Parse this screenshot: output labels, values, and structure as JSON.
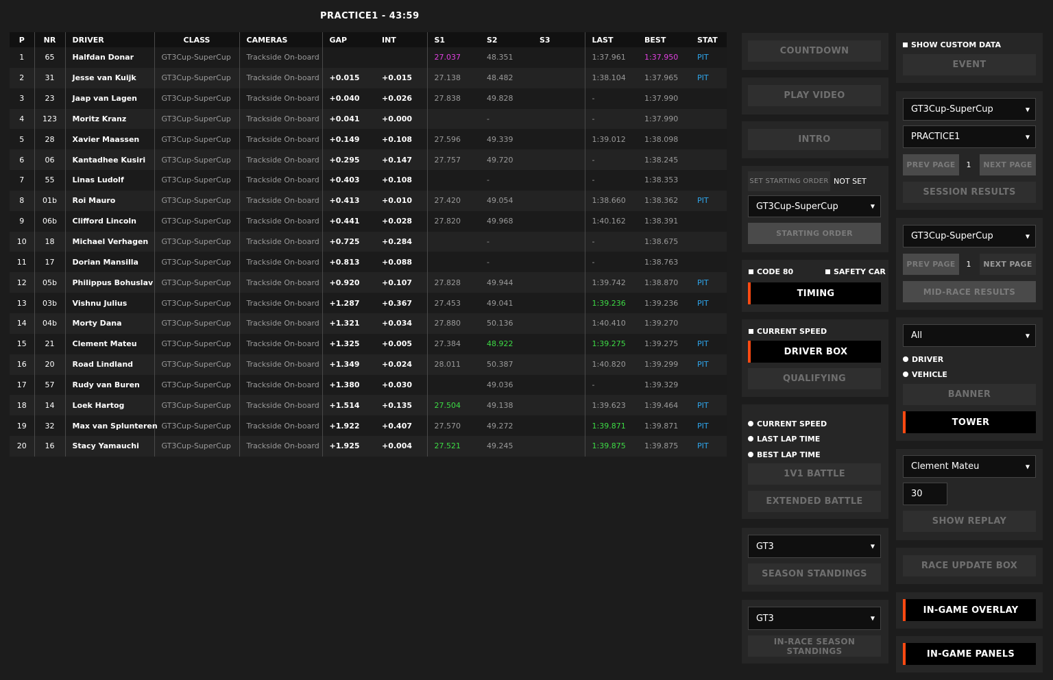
{
  "session_title": "PRACTICE1 - 43:59",
  "columns": [
    "P",
    "NR",
    "DRIVER",
    "CLASS",
    "CAMERAS",
    "GAP",
    "INT",
    "S1",
    "S2",
    "S3",
    "LAST",
    "BEST",
    "STAT"
  ],
  "rows": [
    {
      "p": "1",
      "nr": "65",
      "driver": "Halfdan Donar",
      "class": "GT3Cup-SuperCup",
      "cameras": "Trackside On-board",
      "gap": "",
      "int": "",
      "s1": "27.037",
      "s2": "48.351",
      "s3": "",
      "last": "1:37.961",
      "best": "1:37.950",
      "stat": "PIT",
      "s1c": "purple",
      "s2c": "",
      "lastc": "",
      "bestc": "purple"
    },
    {
      "p": "2",
      "nr": "31",
      "driver": "Jesse van Kuijk",
      "class": "GT3Cup-SuperCup",
      "cameras": "Trackside On-board",
      "gap": "+0.015",
      "int": "+0.015",
      "s1": "27.138",
      "s2": "48.482",
      "s3": "",
      "last": "1:38.104",
      "best": "1:37.965",
      "stat": "PIT",
      "s1c": "",
      "s2c": "",
      "lastc": "",
      "bestc": ""
    },
    {
      "p": "3",
      "nr": "23",
      "driver": "Jaap van Lagen",
      "class": "GT3Cup-SuperCup",
      "cameras": "Trackside On-board",
      "gap": "+0.040",
      "int": "+0.026",
      "s1": "27.838",
      "s2": "49.828",
      "s3": "",
      "last": "-",
      "best": "1:37.990",
      "stat": "",
      "s1c": "",
      "s2c": "",
      "lastc": "",
      "bestc": ""
    },
    {
      "p": "4",
      "nr": "123",
      "driver": "Moritz Kranz",
      "class": "GT3Cup-SuperCup",
      "cameras": "Trackside On-board",
      "gap": "+0.041",
      "int": "+0.000",
      "s1": "",
      "s2": "-",
      "s3": "",
      "last": "-",
      "best": "1:37.990",
      "stat": "",
      "s1c": "",
      "s2c": "",
      "lastc": "",
      "bestc": ""
    },
    {
      "p": "5",
      "nr": "28",
      "driver": "Xavier Maassen",
      "class": "GT3Cup-SuperCup",
      "cameras": "Trackside On-board",
      "gap": "+0.149",
      "int": "+0.108",
      "s1": "27.596",
      "s2": "49.339",
      "s3": "",
      "last": "1:39.012",
      "best": "1:38.098",
      "stat": "",
      "s1c": "",
      "s2c": "",
      "lastc": "",
      "bestc": ""
    },
    {
      "p": "6",
      "nr": "06",
      "driver": "Kantadhee Kusiri",
      "class": "GT3Cup-SuperCup",
      "cameras": "Trackside On-board",
      "gap": "+0.295",
      "int": "+0.147",
      "s1": "27.757",
      "s2": "49.720",
      "s3": "",
      "last": "-",
      "best": "1:38.245",
      "stat": "",
      "s1c": "",
      "s2c": "",
      "lastc": "",
      "bestc": ""
    },
    {
      "p": "7",
      "nr": "55",
      "driver": "Linas Ludolf",
      "class": "GT3Cup-SuperCup",
      "cameras": "Trackside On-board",
      "gap": "+0.403",
      "int": "+0.108",
      "s1": "",
      "s2": "-",
      "s3": "",
      "last": "-",
      "best": "1:38.353",
      "stat": "",
      "s1c": "",
      "s2c": "",
      "lastc": "",
      "bestc": ""
    },
    {
      "p": "8",
      "nr": "01b",
      "driver": "Roi Mauro",
      "class": "GT3Cup-SuperCup",
      "cameras": "Trackside On-board",
      "gap": "+0.413",
      "int": "+0.010",
      "s1": "27.420",
      "s2": "49.054",
      "s3": "",
      "last": "1:38.660",
      "best": "1:38.362",
      "stat": "PIT",
      "s1c": "",
      "s2c": "",
      "lastc": "",
      "bestc": ""
    },
    {
      "p": "9",
      "nr": "06b",
      "driver": "Clifford Lincoln",
      "class": "GT3Cup-SuperCup",
      "cameras": "Trackside On-board",
      "gap": "+0.441",
      "int": "+0.028",
      "s1": "27.820",
      "s2": "49.968",
      "s3": "",
      "last": "1:40.162",
      "best": "1:38.391",
      "stat": "",
      "s1c": "",
      "s2c": "",
      "lastc": "",
      "bestc": ""
    },
    {
      "p": "10",
      "nr": "18",
      "driver": "Michael Verhagen",
      "class": "GT3Cup-SuperCup",
      "cameras": "Trackside On-board",
      "gap": "+0.725",
      "int": "+0.284",
      "s1": "",
      "s2": "-",
      "s3": "",
      "last": "-",
      "best": "1:38.675",
      "stat": "",
      "s1c": "",
      "s2c": "",
      "lastc": "",
      "bestc": ""
    },
    {
      "p": "11",
      "nr": "17",
      "driver": "Dorian Mansilla",
      "class": "GT3Cup-SuperCup",
      "cameras": "Trackside On-board",
      "gap": "+0.813",
      "int": "+0.088",
      "s1": "",
      "s2": "-",
      "s3": "",
      "last": "-",
      "best": "1:38.763",
      "stat": "",
      "s1c": "",
      "s2c": "",
      "lastc": "",
      "bestc": ""
    },
    {
      "p": "12",
      "nr": "05b",
      "driver": "Philippus Bohuslav",
      "class": "GT3Cup-SuperCup",
      "cameras": "Trackside On-board",
      "gap": "+0.920",
      "int": "+0.107",
      "s1": "27.828",
      "s2": "49.944",
      "s3": "",
      "last": "1:39.742",
      "best": "1:38.870",
      "stat": "PIT",
      "s1c": "",
      "s2c": "",
      "lastc": "",
      "bestc": ""
    },
    {
      "p": "13",
      "nr": "03b",
      "driver": "Vishnu Julius",
      "class": "GT3Cup-SuperCup",
      "cameras": "Trackside On-board",
      "gap": "+1.287",
      "int": "+0.367",
      "s1": "27.453",
      "s2": "49.041",
      "s3": "",
      "last": "1:39.236",
      "best": "1:39.236",
      "stat": "PIT",
      "s1c": "",
      "s2c": "",
      "lastc": "green",
      "bestc": ""
    },
    {
      "p": "14",
      "nr": "04b",
      "driver": "Morty Dana",
      "class": "GT3Cup-SuperCup",
      "cameras": "Trackside On-board",
      "gap": "+1.321",
      "int": "+0.034",
      "s1": "27.880",
      "s2": "50.136",
      "s3": "",
      "last": "1:40.410",
      "best": "1:39.270",
      "stat": "",
      "s1c": "",
      "s2c": "",
      "lastc": "",
      "bestc": ""
    },
    {
      "p": "15",
      "nr": "21",
      "driver": "Clement Mateu",
      "class": "GT3Cup-SuperCup",
      "cameras": "Trackside On-board",
      "gap": "+1.325",
      "int": "+0.005",
      "s1": "27.384",
      "s2": "48.922",
      "s3": "",
      "last": "1:39.275",
      "best": "1:39.275",
      "stat": "PIT",
      "s1c": "",
      "s2c": "green",
      "lastc": "green",
      "bestc": ""
    },
    {
      "p": "16",
      "nr": "20",
      "driver": "Road Lindland",
      "class": "GT3Cup-SuperCup",
      "cameras": "Trackside On-board",
      "gap": "+1.349",
      "int": "+0.024",
      "s1": "28.011",
      "s2": "50.387",
      "s3": "",
      "last": "1:40.820",
      "best": "1:39.299",
      "stat": "PIT",
      "s1c": "",
      "s2c": "",
      "lastc": "",
      "bestc": ""
    },
    {
      "p": "17",
      "nr": "57",
      "driver": "Rudy van Buren",
      "class": "GT3Cup-SuperCup",
      "cameras": "Trackside On-board",
      "gap": "+1.380",
      "int": "+0.030",
      "s1": "",
      "s2": "49.036",
      "s3": "",
      "last": "-",
      "best": "1:39.329",
      "stat": "",
      "s1c": "",
      "s2c": "",
      "lastc": "",
      "bestc": ""
    },
    {
      "p": "18",
      "nr": "14",
      "driver": "Loek Hartog",
      "class": "GT3Cup-SuperCup",
      "cameras": "Trackside On-board",
      "gap": "+1.514",
      "int": "+0.135",
      "s1": "27.504",
      "s2": "49.138",
      "s3": "",
      "last": "1:39.623",
      "best": "1:39.464",
      "stat": "PIT",
      "s1c": "green",
      "s2c": "",
      "lastc": "",
      "bestc": ""
    },
    {
      "p": "19",
      "nr": "32",
      "driver": "Max van Splunteren",
      "class": "GT3Cup-SuperCup",
      "cameras": "Trackside On-board",
      "gap": "+1.922",
      "int": "+0.407",
      "s1": "27.570",
      "s2": "49.272",
      "s3": "",
      "last": "1:39.871",
      "best": "1:39.871",
      "stat": "PIT",
      "s1c": "",
      "s2c": "",
      "lastc": "green",
      "bestc": ""
    },
    {
      "p": "20",
      "nr": "16",
      "driver": "Stacy Yamauchi",
      "class": "GT3Cup-SuperCup",
      "cameras": "Trackside On-board",
      "gap": "+1.925",
      "int": "+0.004",
      "s1": "27.521",
      "s2": "49.245",
      "s3": "",
      "last": "1:39.875",
      "best": "1:39.875",
      "stat": "PIT",
      "s1c": "green",
      "s2c": "",
      "lastc": "green",
      "bestc": ""
    }
  ],
  "colors": {
    "accent": "#ff4a12",
    "purple": "#e040e0",
    "green": "#3ddc45",
    "pit_blue": "#2fa7ee"
  },
  "mid": {
    "countdown": "COUNTDOWN",
    "play_video": "PLAY VIDEO",
    "intro": "INTRO",
    "set_starting_order": "SET STARTING ORDER",
    "not_set": "NOT SET",
    "class_select": "GT3Cup-SuperCup",
    "starting_order": "STARTING ORDER",
    "code80": "CODE 80",
    "safety_car": "SAFETY CAR",
    "timing": "TIMING",
    "current_speed": "CURRENT SPEED",
    "driver_box": "DRIVER BOX",
    "qualifying": "QUALIFYING",
    "radio_current_speed": "CURRENT SPEED",
    "radio_last_lap": "LAST LAP TIME",
    "radio_best_lap": "BEST LAP TIME",
    "battle": "1V1 BATTLE",
    "extended_battle": "EXTENDED BATTLE",
    "season_select": "GT3",
    "season_standings": "SEASON STANDINGS",
    "inrace_select": "GT3",
    "inrace_standings": "IN-RACE SEASON STANDINGS"
  },
  "right": {
    "show_custom_data": "SHOW CUSTOM DATA",
    "event": "EVENT",
    "class_select": "GT3Cup-SuperCup",
    "session_select": "PRACTICE1",
    "prev_page": "PREV PAGE",
    "page_num": "1",
    "next_page": "NEXT PAGE",
    "session_results": "SESSION RESULTS",
    "class_select2": "GT3Cup-SuperCup",
    "prev_page2": "PREV PAGE",
    "page_num2": "1",
    "next_page2": "NEXT PAGE",
    "mid_race_results": "MID-RACE RESULTS",
    "filter_select": "All",
    "radio_driver": "DRIVER",
    "radio_vehicle": "VEHICLE",
    "banner": "BANNER",
    "tower": "TOWER",
    "driver_select": "Clement Mateu",
    "replay_seconds": "30",
    "show_replay": "SHOW REPLAY",
    "race_update_box": "RACE UPDATE BOX",
    "in_game_overlay": "IN-GAME OVERLAY",
    "in_game_panels": "IN-GAME PANELS"
  }
}
